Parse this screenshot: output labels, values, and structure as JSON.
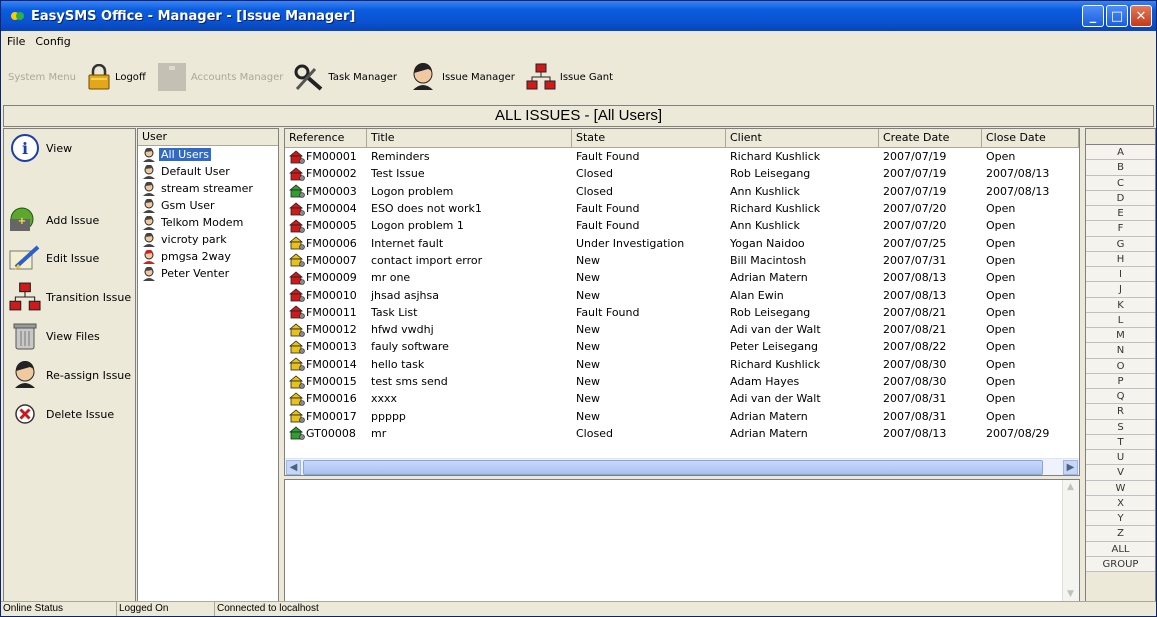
{
  "window": {
    "title": "EasySMS Office - Manager - [Issue Manager]"
  },
  "menu": [
    "File",
    "Config"
  ],
  "toolbar": {
    "system_menu": "System Menu",
    "logoff": "Logoff",
    "accounts_manager": "Accounts Manager",
    "task_manager": "Task Manager",
    "issue_manager": "Issue Manager",
    "issue_gant": "Issue Gant"
  },
  "banner": "ALL ISSUES - [All Users]",
  "actions": {
    "view": "View",
    "add_issue": "Add Issue",
    "edit_issue": "Edit Issue",
    "transition_issue": "Transition Issue",
    "view_files": "View Files",
    "reassign_issue": "Re-assign Issue",
    "delete_issue": "Delete Issue"
  },
  "users": {
    "header": "User",
    "items": [
      {
        "name": "All Users",
        "selected": true,
        "color": "#444444"
      },
      {
        "name": "Default User",
        "color": "#444444"
      },
      {
        "name": "stream streamer",
        "color": "#444444"
      },
      {
        "name": "Gsm User",
        "color": "#444444"
      },
      {
        "name": "Telkom Modem",
        "color": "#444444"
      },
      {
        "name": "vicroty park",
        "color": "#444444"
      },
      {
        "name": "pmgsa 2way",
        "color": "#cc2222"
      },
      {
        "name": "Peter Venter",
        "color": "#444444"
      }
    ]
  },
  "grid": {
    "columns": [
      "Reference",
      "Title",
      "State",
      "Client",
      "Create Date",
      "Close Date"
    ],
    "rows": [
      {
        "ref": "FM00001",
        "title": "Reminders",
        "state": "Fault Found",
        "client": "Richard Kushlick",
        "created": "2007/07/19",
        "closed": "Open",
        "icon": "red"
      },
      {
        "ref": "FM00002",
        "title": "Test Issue",
        "state": "Closed",
        "client": "Rob Leisegang",
        "created": "2007/07/19",
        "closed": "2007/08/13",
        "icon": "red"
      },
      {
        "ref": "FM00003",
        "title": "Logon problem",
        "state": "Closed",
        "client": "Ann Kushlick",
        "created": "2007/07/19",
        "closed": "2007/08/13",
        "icon": "green"
      },
      {
        "ref": "FM00004",
        "title": "ESO does not work1",
        "state": "Fault Found",
        "client": "Richard Kushlick",
        "created": "2007/07/20",
        "closed": "Open",
        "icon": "red"
      },
      {
        "ref": "FM00005",
        "title": "Logon problem 1",
        "state": "Fault Found",
        "client": "Ann Kushlick",
        "created": "2007/07/20",
        "closed": "Open",
        "icon": "red"
      },
      {
        "ref": "FM00006",
        "title": "Internet fault",
        "state": "Under Investigation",
        "client": "Yogan Naidoo",
        "created": "2007/07/25",
        "closed": "Open",
        "icon": "yellow"
      },
      {
        "ref": "FM00007",
        "title": "contact import error",
        "state": "New",
        "client": "Bill Macintosh",
        "created": "2007/07/31",
        "closed": "Open",
        "icon": "yellow"
      },
      {
        "ref": "FM00009",
        "title": "mr one",
        "state": "New",
        "client": "Adrian Matern",
        "created": "2007/08/13",
        "closed": "Open",
        "icon": "red"
      },
      {
        "ref": "FM00010",
        "title": "jhsad asjhsa",
        "state": "New",
        "client": "Alan Ewin",
        "created": "2007/08/13",
        "closed": "Open",
        "icon": "red"
      },
      {
        "ref": "FM00011",
        "title": "Task List",
        "state": "Fault Found",
        "client": "Rob Leisegang",
        "created": "2007/08/21",
        "closed": "Open",
        "icon": "red"
      },
      {
        "ref": "FM00012",
        "title": "hfwd vwdhj",
        "state": "New",
        "client": "Adi van der Walt",
        "created": "2007/08/21",
        "closed": "Open",
        "icon": "yellow"
      },
      {
        "ref": "FM00013",
        "title": "fauly software",
        "state": "New",
        "client": "Peter Leisegang",
        "created": "2007/08/22",
        "closed": "Open",
        "icon": "yellow"
      },
      {
        "ref": "FM00014",
        "title": "hello task",
        "state": "New",
        "client": "Richard Kushlick",
        "created": "2007/08/30",
        "closed": "Open",
        "icon": "yellow"
      },
      {
        "ref": "FM00015",
        "title": "test sms send",
        "state": "New",
        "client": "Adam Hayes",
        "created": "2007/08/30",
        "closed": "Open",
        "icon": "yellow"
      },
      {
        "ref": "FM00016",
        "title": "xxxx",
        "state": "New",
        "client": "Adi van der Walt",
        "created": "2007/08/31",
        "closed": "Open",
        "icon": "yellow"
      },
      {
        "ref": "FM00017",
        "title": "ppppp",
        "state": "New",
        "client": "Adrian Matern",
        "created": "2007/08/31",
        "closed": "Open",
        "icon": "yellow"
      },
      {
        "ref": "GT00008",
        "title": "mr",
        "state": "Closed",
        "client": "Adrian Matern",
        "created": "2007/08/13",
        "closed": "2007/08/29",
        "icon": "green"
      }
    ]
  },
  "letters": [
    "A",
    "B",
    "C",
    "D",
    "E",
    "F",
    "G",
    "H",
    "I",
    "J",
    "K",
    "L",
    "M",
    "N",
    "O",
    "P",
    "Q",
    "R",
    "S",
    "T",
    "U",
    "V",
    "W",
    "X",
    "Y",
    "Z",
    "ALL",
    "GROUP"
  ],
  "status": {
    "online": "Online Status",
    "logged": "Logged On",
    "connected": "Connected to localhost"
  }
}
